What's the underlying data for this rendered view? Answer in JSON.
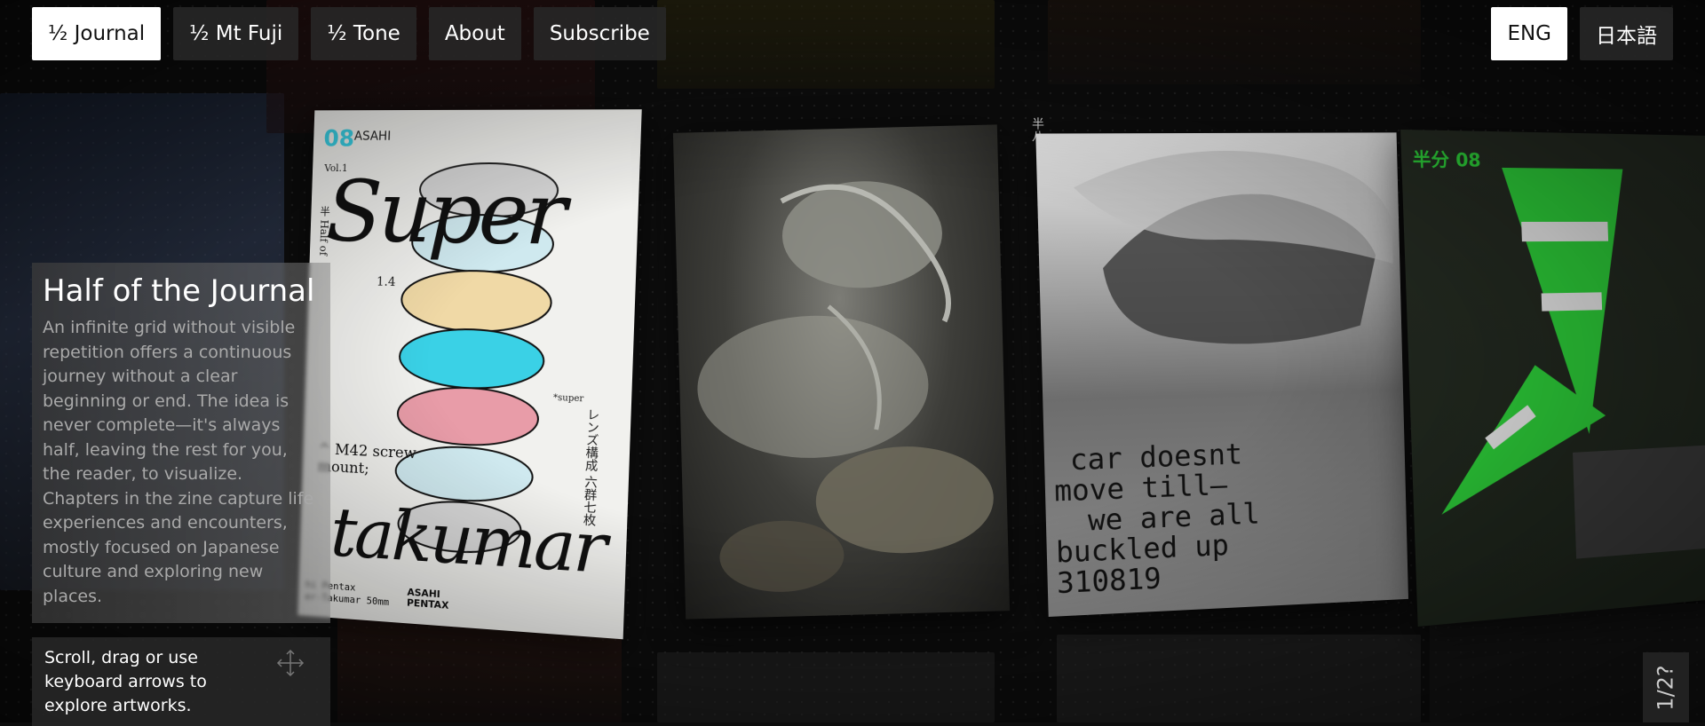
{
  "nav": {
    "items": [
      {
        "label": "½ Journal",
        "active": true
      },
      {
        "label": "½ Mt Fuji",
        "active": false
      },
      {
        "label": "½ Tone",
        "active": false
      },
      {
        "label": "About",
        "active": false
      },
      {
        "label": "Subscribe",
        "active": false
      }
    ]
  },
  "language": {
    "options": [
      {
        "label": "ENG",
        "active": true
      },
      {
        "label": "日本語",
        "active": false
      }
    ]
  },
  "info_panel": {
    "title": "Half of the Journal",
    "description": "An infinite grid without visible repetition offers a continuous journey without a clear beginning or end. The idea is never complete—it's always half, leaving the rest for you, the reader, to visualize. Chapters in the zine capture life experiences and encounters, mostly focused on Japanese culture and exploring new places."
  },
  "hint": {
    "text": "Scroll, drag or use keyboard arrows to explore artworks.",
    "icon": "move-arrows-icon"
  },
  "artworks": {
    "left": {
      "brand_top": "ASAHI",
      "issue": "08",
      "vol": "Vol.1",
      "side_text": "半 Half of",
      "number": "1.4",
      "word_top": "Super",
      "spec": "^ M42 screw mount;",
      "word_bottom": "takumar",
      "footer_left": "hi Pentax",
      "footer_left2": "er-Takumar 50mm",
      "logo": "ASAHI PENTAX",
      "side_jp": "レンズ構成 六群七枚",
      "small_label": "*super"
    },
    "center": {
      "corner_mark": "半八"
    },
    "right": {
      "line1": "car doesnt",
      "line2": "move till—",
      "line3": "we are all",
      "line4": "buckled up",
      "date": "310819"
    },
    "far_right": {
      "label": "半分 08"
    }
  },
  "half_mark": "1/2?",
  "colors": {
    "accent_cyan": "#3ad1e6",
    "accent_red": "#d1202a",
    "accent_green": "#2ed13a"
  }
}
